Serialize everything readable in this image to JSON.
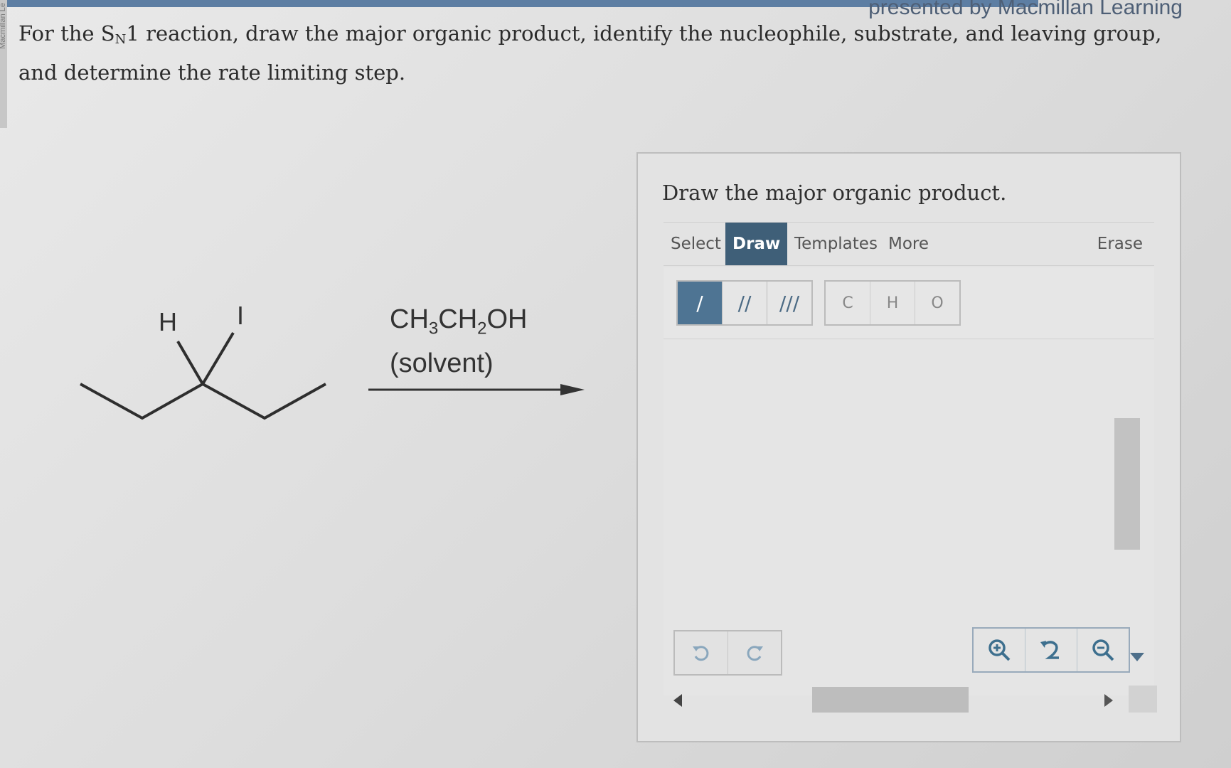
{
  "publisher": "presented by Macmillan Learning",
  "side_label": "Macmillan Le",
  "question": {
    "part1": "For the S",
    "sub": "N",
    "part2": "1 reaction, draw the major organic product, identify the nucleophile, substrate, and leaving group, and determine the rate limiting step."
  },
  "reactant": {
    "atom_h": "H",
    "atom_i": "I"
  },
  "reagent": {
    "f1": "CH",
    "s1": "3",
    "f2": "CH",
    "s2": "2",
    "f3": "OH",
    "solvent": "(solvent)"
  },
  "panel": {
    "title": "Draw the major organic product.",
    "toolbar": {
      "select": "Select",
      "draw": "Draw",
      "templates": "Templates",
      "more": "More",
      "erase": "Erase"
    },
    "bonds": {
      "single": "/",
      "double": "//",
      "triple": "///"
    },
    "atoms": {
      "c": "C",
      "h": "H",
      "o": "O"
    },
    "icons": {
      "undo": "undo-icon",
      "redo": "redo-icon",
      "zoom_in": "zoom-in-icon",
      "zoom_reset": "zoom-reset-icon",
      "zoom_out": "zoom-out-icon"
    }
  }
}
